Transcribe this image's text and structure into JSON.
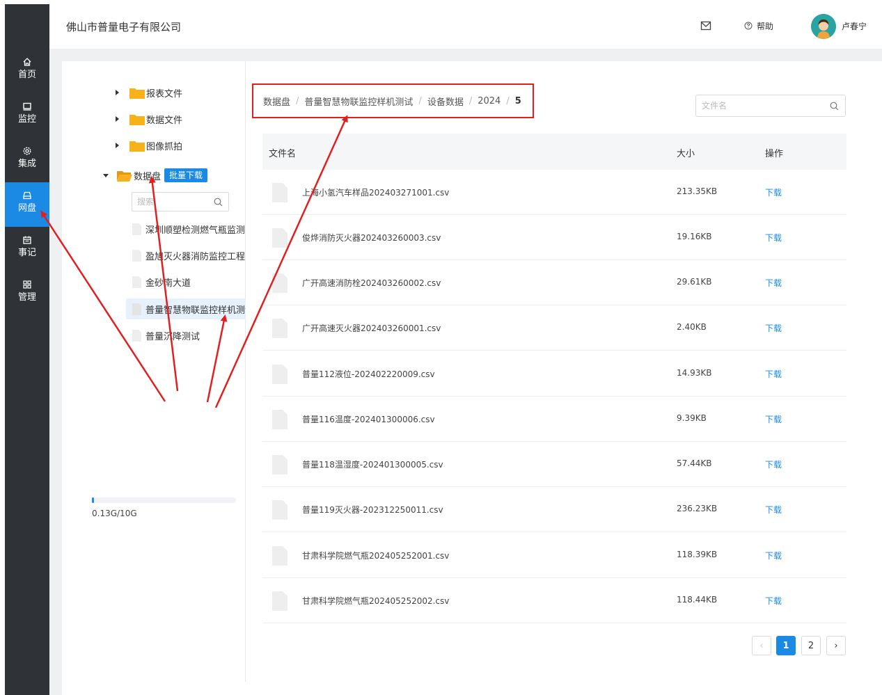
{
  "nav": {
    "items": [
      {
        "label": "首页",
        "icon": "home-icon"
      },
      {
        "label": "监控",
        "icon": "monitor-icon"
      },
      {
        "label": "集成",
        "icon": "gear-icon"
      },
      {
        "label": "网盘",
        "icon": "drive-icon",
        "active": true
      },
      {
        "label": "事记",
        "icon": "calendar-icon"
      },
      {
        "label": "管理",
        "icon": "grid-icon"
      }
    ]
  },
  "header": {
    "company": "佛山市普量电子有限公司",
    "help_label": "帮助",
    "user_name": "卢春宁"
  },
  "tree": {
    "folders": [
      {
        "label": "报表文件"
      },
      {
        "label": "数据文件"
      },
      {
        "label": "图像抓拍"
      }
    ],
    "disk": {
      "label": "数据盘",
      "batch_label": "批量下载"
    },
    "search_placeholder": "搜索",
    "files": [
      {
        "label": "深圳顺塑检测燃气瓶监测"
      },
      {
        "label": "盈旭灭火器消防监控工程"
      },
      {
        "label": "金砂南大道"
      },
      {
        "label": "普量智慧物联监控样机测试",
        "selected": true
      },
      {
        "label": "普量沉降测试"
      }
    ],
    "storage": {
      "used_fraction": 0.013,
      "text": "0.13G/10G"
    }
  },
  "breadcrumb": [
    "数据盘",
    "普量智慧物联监控样机测试",
    "设备数据",
    "2024",
    "5"
  ],
  "file_search_placeholder": "文件名",
  "table": {
    "headers": {
      "name": "文件名",
      "size": "大小",
      "action": "操作"
    },
    "rows": [
      {
        "name": "上海小氢汽车样品202403271001.csv",
        "size": "213.35KB",
        "action": "下载"
      },
      {
        "name": "俊烨消防灭火器202403260003.csv",
        "size": "19.16KB",
        "action": "下载"
      },
      {
        "name": "广开高速消防栓202403260002.csv",
        "size": "29.61KB",
        "action": "下载"
      },
      {
        "name": "广开高速灭火器202403260001.csv",
        "size": "2.40KB",
        "action": "下载"
      },
      {
        "name": "普量112液位-202402220009.csv",
        "size": "14.93KB",
        "action": "下载"
      },
      {
        "name": "普量116温度-202401300006.csv",
        "size": "9.39KB",
        "action": "下载"
      },
      {
        "name": "普量118温湿度-202401300005.csv",
        "size": "57.44KB",
        "action": "下载"
      },
      {
        "name": "普量119灭火器-202312250011.csv",
        "size": "236.23KB",
        "action": "下载"
      },
      {
        "name": "甘肃科学院燃气瓶202405252001.csv",
        "size": "118.39KB",
        "action": "下载"
      },
      {
        "name": "甘肃科学院燃气瓶202405252002.csv",
        "size": "118.44KB",
        "action": "下载"
      }
    ]
  },
  "pagination": {
    "prev": "‹",
    "pages": [
      "1",
      "2"
    ],
    "current": "1",
    "next": "›"
  },
  "colors": {
    "accent": "#1a8ae5",
    "rail": "#2f3236",
    "highlight": "#e11f1f",
    "folder": "#f7b21b"
  }
}
